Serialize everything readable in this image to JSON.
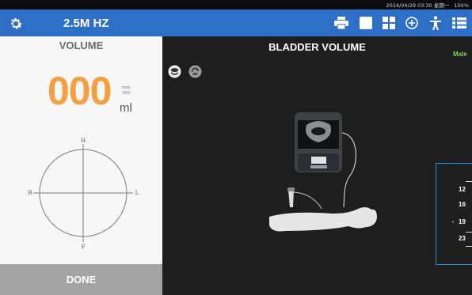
{
  "status": {
    "datetime": "2024/04/29 03:30 星期一",
    "battery": "100%"
  },
  "toolbar": {
    "frequency": "2.5M HZ",
    "icons": [
      "gear-icon",
      "printer-icon",
      "square-icon",
      "grid-icon",
      "add-circle-icon",
      "person-icon",
      "list-icon"
    ]
  },
  "volume_panel": {
    "title": "VOLUME",
    "value": "000",
    "max_label": "max",
    "max_value": "000",
    "unit": "ml",
    "orientation": {
      "top": "H",
      "bottom": "F",
      "left": "R",
      "right": "L"
    },
    "done_label": "DONE"
  },
  "main": {
    "title": "BLADDER VOLUME",
    "gender": "Male",
    "buttons": [
      "supine-mode-icon",
      "rotate-mode-icon"
    ]
  },
  "depth_scale": {
    "values": [
      "12",
      "16",
      "19",
      "23"
    ],
    "current": "19"
  },
  "colors": {
    "accent_blue": "#2d6fc6",
    "volume_orange": "#f5a040",
    "gender_green": "#7fd65a",
    "scale_border": "#2e8fd6"
  }
}
